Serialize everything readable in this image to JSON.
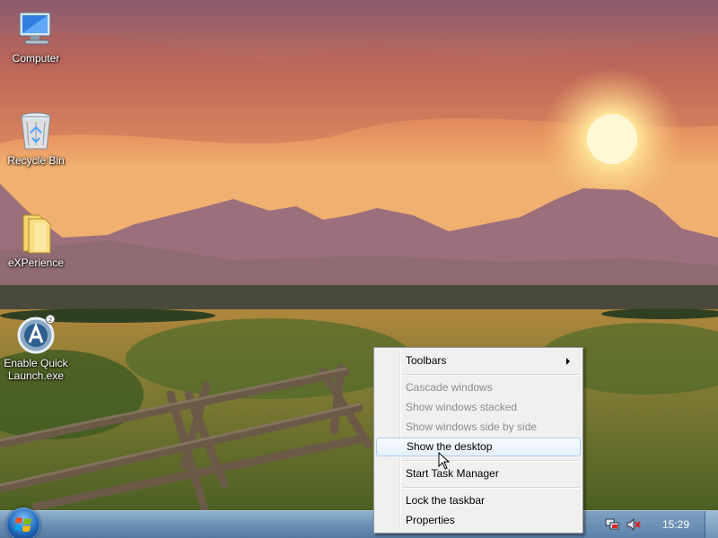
{
  "desktop": {
    "icons": [
      {
        "label": "Computer"
      },
      {
        "label": "Recycle Bin"
      },
      {
        "label": "eXPerience"
      },
      {
        "label": "Enable Quick\nLaunch.exe"
      }
    ]
  },
  "context_menu": {
    "items": [
      {
        "label": "Toolbars",
        "submenu": true,
        "enabled": true
      },
      {
        "label": "Cascade windows",
        "enabled": false
      },
      {
        "label": "Show windows stacked",
        "enabled": false
      },
      {
        "label": "Show windows side by side",
        "enabled": false
      },
      {
        "label": "Show the desktop",
        "enabled": true,
        "highlighted": true
      },
      {
        "label": "Start Task Manager",
        "enabled": true
      },
      {
        "label": "Lock the taskbar",
        "enabled": true
      },
      {
        "label": "Properties",
        "enabled": true
      }
    ]
  },
  "taskbar": {
    "clock": "15:29",
    "tray_icons": [
      "network-icon",
      "volume-muted-icon"
    ],
    "start_icon": "windows-logo-icon"
  },
  "colors": {
    "taskbar": "#6f93b6",
    "menu_background": "#f0f0f0",
    "highlight_border": "#aecff7"
  }
}
